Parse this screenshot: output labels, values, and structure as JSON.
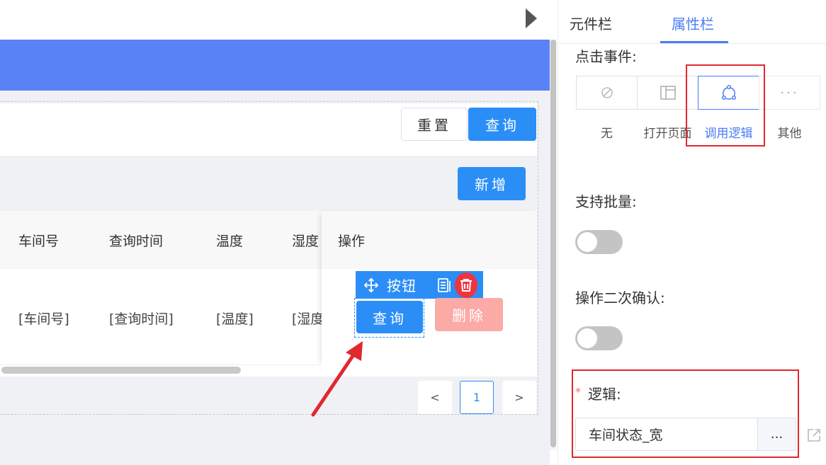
{
  "canvas": {
    "search": {
      "reset_label": "重置",
      "query_label": "查询"
    },
    "toolbar": {
      "add_label": "新增"
    },
    "table": {
      "headers": [
        "车间号",
        "查询时间",
        "温度",
        "湿度",
        "操作"
      ],
      "row": [
        "[车间号]",
        "[查询时间]",
        "[温度]",
        "[湿度"
      ],
      "row_actions": {
        "query_label": "查询",
        "delete_label": "删除"
      }
    },
    "selected_toolbar": {
      "label": "按钮"
    },
    "pager": {
      "prev": "<",
      "page": "1",
      "next": ">"
    }
  },
  "panel": {
    "tabs": [
      "元件栏",
      "属性栏"
    ],
    "active_tab": 1,
    "click_event": {
      "label": "点击事件:",
      "options": [
        {
          "label": "无",
          "icon": "ban-icon"
        },
        {
          "label": "打开页面",
          "icon": "layout-icon"
        },
        {
          "label": "调用逻辑",
          "icon": "logic-nodes-icon",
          "selected": true
        },
        {
          "label": "其他",
          "icon": "more-dots-icon"
        }
      ]
    },
    "batch": {
      "label": "支持批量:",
      "on": false
    },
    "confirm": {
      "label": "操作二次确认:",
      "on": false
    },
    "logic": {
      "required_mark": "*",
      "label": "逻辑:",
      "value": "车间状态_宽",
      "more_label": "..."
    }
  },
  "colors": {
    "primary": "#2b8ef7",
    "header_blue": "#5a82f7",
    "accent": "#4a7df6",
    "danger": "#f0343f",
    "highlight_red": "#e0282f"
  }
}
